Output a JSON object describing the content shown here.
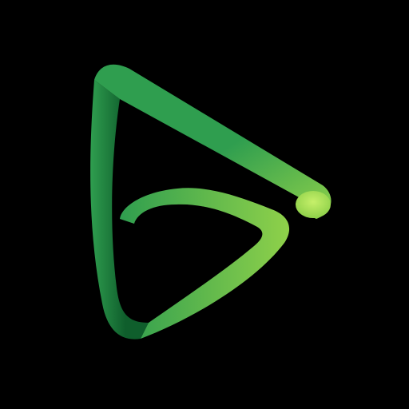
{
  "background_color": "#000000",
  "logo": {
    "icon": "green-play-triangle-swirl-logo-icon",
    "colors": {
      "dark_green": "#0f5e2c",
      "mid_green": "#2f9e4f",
      "light_green": "#8fd14a",
      "highlight": "#c6f06a"
    }
  }
}
